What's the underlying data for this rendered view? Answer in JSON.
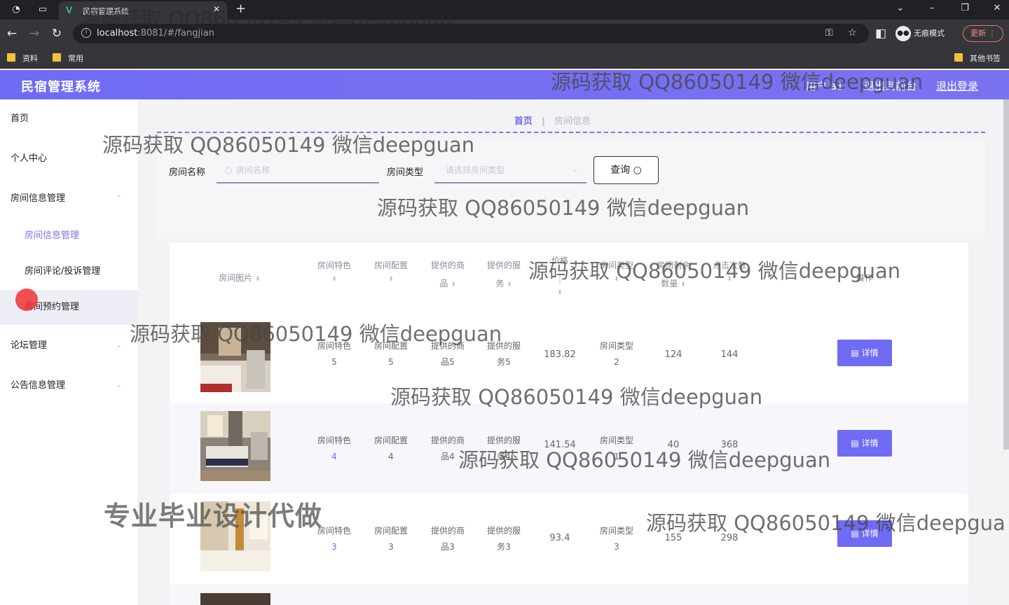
{
  "browser": {
    "tab_title": "民宿管理系统",
    "url_host": "localhost",
    "url_path": ":8081/#/fangjian",
    "incognito_label": "无痕模式",
    "update_label": "更新",
    "bookmarks": [
      "资料",
      "常用"
    ],
    "other_bookmarks": "其他书签"
  },
  "header": {
    "title": "民宿管理系统",
    "user_label": "用户 a1",
    "front_label": "退出到前台",
    "logout_label": "退出登录"
  },
  "sidebar": {
    "items": [
      {
        "label": "首页"
      },
      {
        "label": "个人中心"
      },
      {
        "label": "房间信息管理"
      },
      {
        "label": "房间信息管理"
      },
      {
        "label": "房间评论/投诉管理"
      },
      {
        "label": "房间预约管理"
      },
      {
        "label": "论坛管理"
      },
      {
        "label": "公告信息管理"
      }
    ]
  },
  "breadcrumb": {
    "home": "首页",
    "current": "房间信息"
  },
  "search": {
    "name_label": "房间名称",
    "name_placeholder": "房间名称",
    "type_label": "房间类型",
    "type_placeholder": "请选择房间类型",
    "button_label": "查询"
  },
  "table": {
    "columns": [
      "房间图片",
      "房间特色",
      "房间配置",
      "提供的商品",
      "提供的服务",
      "价格",
      "房间类型",
      "房间剩余数量",
      "点击次数",
      "操作"
    ],
    "rows": [
      {
        "tese": [
          "房间特色",
          "5"
        ],
        "peizhi": [
          "房间配置",
          "5"
        ],
        "shangpin": [
          "提供的商",
          "品5"
        ],
        "fuwu": [
          "提供的服",
          "务5"
        ],
        "price": "183.82",
        "type": [
          "房间类型",
          "2"
        ],
        "count": "124",
        "clicks": "144",
        "detail": "详情"
      },
      {
        "tese": [
          "房间特色",
          "4"
        ],
        "peizhi": [
          "房间配置",
          "4"
        ],
        "shangpin": [
          "提供的商",
          "品4"
        ],
        "fuwu": [
          "提供的服",
          "务4"
        ],
        "price": "141.54",
        "type": [
          "房间类型",
          "1"
        ],
        "count": "40",
        "clicks": "368",
        "detail": "详情"
      },
      {
        "tese": [
          "房间特色",
          "3"
        ],
        "peizhi": [
          "房间配置",
          "3"
        ],
        "shangpin": [
          "提供的商",
          "品3"
        ],
        "fuwu": [
          "提供的服",
          "务3"
        ],
        "price": "93.4",
        "type": [
          "房间类型",
          "3"
        ],
        "count": "155",
        "clicks": "298",
        "detail": "详情"
      }
    ]
  },
  "watermark": "源码获取 QQ86050149 微信deepguan",
  "watermark_cut": "源码获取 QQ86050149 微信deepgua",
  "promo": "专业毕业设计代做",
  "colors": {
    "accent": "#6f6bf4",
    "header": "#7b72f0"
  }
}
